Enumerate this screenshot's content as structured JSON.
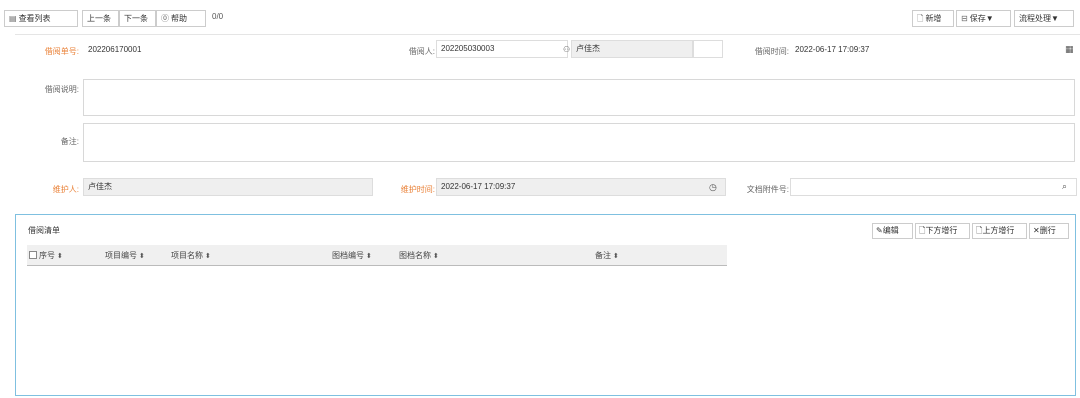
{
  "toolbar": {
    "view_list": "查看列表",
    "prev": "上一条",
    "next": "下一条",
    "help": "帮助",
    "counter": "0/0",
    "new": "新增",
    "save": "保存▼",
    "workflow": "流程处理▼"
  },
  "form": {
    "borrow_no_label": "借阅单号:",
    "borrow_no_value": "202206170001",
    "borrower_label": "借阅人:",
    "borrower_id": "202205030003",
    "borrower_name": "卢佳杰",
    "borrow_time_label": "借阅时间:",
    "borrow_time_value": "2022-06-17 17:09:37",
    "description_label": "借阅说明:",
    "description_value": "",
    "remark_label": "备注:",
    "remark_value": "",
    "maintainer_label": "维护人:",
    "maintainer_value": "卢佳杰",
    "maintain_time_label": "维护时间:",
    "maintain_time_value": "2022-06-17 17:09:37",
    "attachment_label": "文档附件号:",
    "attachment_value": ""
  },
  "grid": {
    "title": "借阅清单",
    "edit": "编辑",
    "insert_below": "下方增行",
    "insert_above": "上方增行",
    "delete_row": "删行",
    "columns": [
      "序号",
      "项目编号",
      "项目名称",
      "图档编号",
      "图档名称",
      "备注"
    ],
    "rows": []
  },
  "icons": {
    "view_list": "list-icon",
    "help": "question-circle-icon",
    "new": "file-add-icon",
    "save": "save-icon",
    "borrower": "org-tree-icon",
    "calendar": "calendar-icon",
    "clock": "clock-icon",
    "attachment": "paperclip-icon"
  }
}
